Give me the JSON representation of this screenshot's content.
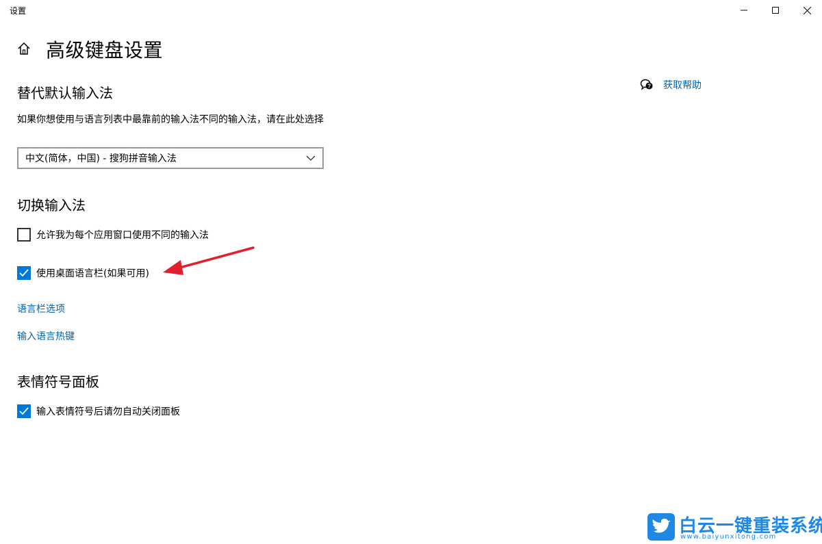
{
  "window": {
    "app_title": "设置",
    "page_title": "高级键盘设置"
  },
  "help": {
    "label": "获取帮助"
  },
  "sections": {
    "override": {
      "title": "替代默认输入法",
      "description": "如果你想使用与语言列表中最靠前的输入法不同的输入法，请在此处选择",
      "dropdown_value": "中文(简体，中国) - 搜狗拼音输入法"
    },
    "switch": {
      "title": "切换输入法",
      "checkbox_per_app": {
        "label": "允许我为每个应用窗口使用不同的输入法",
        "checked": false
      },
      "checkbox_langbar": {
        "label": "使用桌面语言栏(如果可用)",
        "checked": true
      },
      "link_langbar_options": "语言栏选项",
      "link_hotkeys": "输入语言热键"
    },
    "emoji": {
      "title": "表情符号面板",
      "checkbox_autoclose": {
        "label": "输入表情符号后请勿自动关闭面板",
        "checked": true
      }
    }
  },
  "watermark": {
    "text": "白云一键重装系统",
    "url_text": "www.baiyunxitong.com"
  },
  "colors": {
    "accent": "#0078d7",
    "link": "#0063b1",
    "annotation": "#e0202a"
  }
}
